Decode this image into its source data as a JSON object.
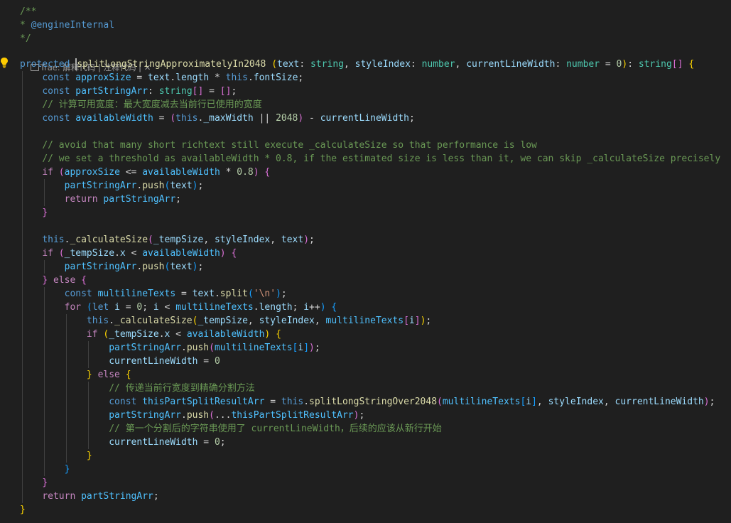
{
  "code_lens": {
    "prefix": "Trae: ",
    "explain_label": "解释代码",
    "separator": " | ",
    "comment_label": "注释代码",
    "separator2": " | ",
    "close_glyph": "✕"
  },
  "icons": {
    "lightbulb": "lightbulb-icon",
    "code_lens": "trae-code-icon"
  },
  "colors": {
    "background": "#1f1f1f",
    "keyword": "#569cd6",
    "control": "#c586c0",
    "variable": "#9cdcfe",
    "function": "#dcdcaa",
    "type": "#4ec9b0",
    "string": "#ce9178",
    "number": "#b5cea8",
    "comment": "#6a9955",
    "lightbulb": "#ffcc00"
  },
  "lines": [
    [
      [
        "cmt",
        "/**"
      ]
    ],
    [
      [
        "cmt",
        "* "
      ],
      [
        "at",
        "@engineInternal"
      ]
    ],
    [
      [
        "cmt",
        "*/"
      ]
    ],
    [
      [
        "kw",
        "protected"
      ],
      [
        "p",
        " "
      ],
      [
        "cursor",
        ""
      ],
      [
        "fn",
        "splitLongStringApproximatelyIn2048"
      ],
      [
        "p",
        " "
      ],
      [
        "b1",
        "("
      ],
      [
        "var",
        "text"
      ],
      [
        "p",
        ": "
      ],
      [
        "type",
        "string"
      ],
      [
        "p",
        ", "
      ],
      [
        "var",
        "styleIndex"
      ],
      [
        "p",
        ": "
      ],
      [
        "type",
        "number"
      ],
      [
        "p",
        ", "
      ],
      [
        "var",
        "currentLineWidth"
      ],
      [
        "p",
        ": "
      ],
      [
        "type",
        "number"
      ],
      [
        "p",
        " = "
      ],
      [
        "num",
        "0"
      ],
      [
        "b1",
        ")"
      ],
      [
        "p",
        ": "
      ],
      [
        "type",
        "string"
      ],
      [
        "b2",
        "[]"
      ],
      [
        "p",
        " "
      ],
      [
        "b1",
        "{"
      ]
    ],
    [
      [
        "p",
        "    "
      ],
      [
        "kw",
        "const"
      ],
      [
        "p",
        " "
      ],
      [
        "cst",
        "approxSize"
      ],
      [
        "p",
        " = "
      ],
      [
        "var",
        "text"
      ],
      [
        "p",
        "."
      ],
      [
        "var",
        "length"
      ],
      [
        "p",
        " * "
      ],
      [
        "kw",
        "this"
      ],
      [
        "p",
        "."
      ],
      [
        "var",
        "fontSize"
      ],
      [
        "p",
        ";"
      ]
    ],
    [
      [
        "p",
        "    "
      ],
      [
        "kw",
        "const"
      ],
      [
        "p",
        " "
      ],
      [
        "cst",
        "partStringArr"
      ],
      [
        "p",
        ": "
      ],
      [
        "type",
        "string"
      ],
      [
        "b2",
        "[]"
      ],
      [
        "p",
        " = "
      ],
      [
        "b2",
        "[]"
      ],
      [
        "p",
        ";"
      ]
    ],
    [
      [
        "p",
        "    "
      ],
      [
        "cmt",
        "// 计算可用宽度：最大宽度减去当前行已使用的宽度"
      ]
    ],
    [
      [
        "p",
        "    "
      ],
      [
        "kw",
        "const"
      ],
      [
        "p",
        " "
      ],
      [
        "cst",
        "availableWidth"
      ],
      [
        "p",
        " = "
      ],
      [
        "b2",
        "("
      ],
      [
        "kw",
        "this"
      ],
      [
        "p",
        "."
      ],
      [
        "var",
        "_maxWidth"
      ],
      [
        "p",
        " || "
      ],
      [
        "num",
        "2048"
      ],
      [
        "b2",
        ")"
      ],
      [
        "p",
        " - "
      ],
      [
        "var",
        "currentLineWidth"
      ],
      [
        "p",
        ";"
      ]
    ],
    [],
    [
      [
        "p",
        "    "
      ],
      [
        "cmt",
        "// avoid that many short richtext still execute _calculateSize so that performance is low"
      ]
    ],
    [
      [
        "p",
        "    "
      ],
      [
        "cmt",
        "// we set a threshold as availableWidth * 0.8, if the estimated size is less than it, we can skip _calculateSize precisely"
      ]
    ],
    [
      [
        "p",
        "    "
      ],
      [
        "ctl",
        "if"
      ],
      [
        "p",
        " "
      ],
      [
        "b2",
        "("
      ],
      [
        "cst",
        "approxSize"
      ],
      [
        "p",
        " <= "
      ],
      [
        "cst",
        "availableWidth"
      ],
      [
        "p",
        " * "
      ],
      [
        "num",
        "0.8"
      ],
      [
        "b2",
        ")"
      ],
      [
        "p",
        " "
      ],
      [
        "b2",
        "{"
      ]
    ],
    [
      [
        "p",
        "        "
      ],
      [
        "cst",
        "partStringArr"
      ],
      [
        "p",
        "."
      ],
      [
        "fn",
        "push"
      ],
      [
        "b3",
        "("
      ],
      [
        "var",
        "text"
      ],
      [
        "b3",
        ")"
      ],
      [
        "p",
        ";"
      ]
    ],
    [
      [
        "p",
        "        "
      ],
      [
        "ctl",
        "return"
      ],
      [
        "p",
        " "
      ],
      [
        "cst",
        "partStringArr"
      ],
      [
        "p",
        ";"
      ]
    ],
    [
      [
        "p",
        "    "
      ],
      [
        "b2",
        "}"
      ]
    ],
    [],
    [
      [
        "p",
        "    "
      ],
      [
        "kw",
        "this"
      ],
      [
        "p",
        "."
      ],
      [
        "fn",
        "_calculateSize"
      ],
      [
        "b2",
        "("
      ],
      [
        "var",
        "_tempSize"
      ],
      [
        "p",
        ", "
      ],
      [
        "var",
        "styleIndex"
      ],
      [
        "p",
        ", "
      ],
      [
        "var",
        "text"
      ],
      [
        "b2",
        ")"
      ],
      [
        "p",
        ";"
      ]
    ],
    [
      [
        "p",
        "    "
      ],
      [
        "ctl",
        "if"
      ],
      [
        "p",
        " "
      ],
      [
        "b2",
        "("
      ],
      [
        "var",
        "_tempSize"
      ],
      [
        "p",
        "."
      ],
      [
        "var",
        "x"
      ],
      [
        "p",
        " < "
      ],
      [
        "cst",
        "availableWidth"
      ],
      [
        "b2",
        ")"
      ],
      [
        "p",
        " "
      ],
      [
        "b2",
        "{"
      ]
    ],
    [
      [
        "p",
        "        "
      ],
      [
        "cst",
        "partStringArr"
      ],
      [
        "p",
        "."
      ],
      [
        "fn",
        "push"
      ],
      [
        "b3",
        "("
      ],
      [
        "var",
        "text"
      ],
      [
        "b3",
        ")"
      ],
      [
        "p",
        ";"
      ]
    ],
    [
      [
        "p",
        "    "
      ],
      [
        "b2",
        "}"
      ],
      [
        "p",
        " "
      ],
      [
        "ctl",
        "else"
      ],
      [
        "p",
        " "
      ],
      [
        "b2",
        "{"
      ]
    ],
    [
      [
        "p",
        "        "
      ],
      [
        "kw",
        "const"
      ],
      [
        "p",
        " "
      ],
      [
        "cst",
        "multilineTexts"
      ],
      [
        "p",
        " = "
      ],
      [
        "var",
        "text"
      ],
      [
        "p",
        "."
      ],
      [
        "fn",
        "split"
      ],
      [
        "b3",
        "("
      ],
      [
        "str",
        "'\\n'"
      ],
      [
        "b3",
        ")"
      ],
      [
        "p",
        ";"
      ]
    ],
    [
      [
        "p",
        "        "
      ],
      [
        "ctl",
        "for"
      ],
      [
        "p",
        " "
      ],
      [
        "b3",
        "("
      ],
      [
        "kw",
        "let"
      ],
      [
        "p",
        " "
      ],
      [
        "var",
        "i"
      ],
      [
        "p",
        " = "
      ],
      [
        "num",
        "0"
      ],
      [
        "p",
        "; "
      ],
      [
        "var",
        "i"
      ],
      [
        "p",
        " < "
      ],
      [
        "cst",
        "multilineTexts"
      ],
      [
        "p",
        "."
      ],
      [
        "var",
        "length"
      ],
      [
        "p",
        "; "
      ],
      [
        "var",
        "i"
      ],
      [
        "p",
        "++"
      ],
      [
        "b3",
        ")"
      ],
      [
        "p",
        " "
      ],
      [
        "b3",
        "{"
      ]
    ],
    [
      [
        "p",
        "            "
      ],
      [
        "kw",
        "this"
      ],
      [
        "p",
        "."
      ],
      [
        "fn",
        "_calculateSize"
      ],
      [
        "b1",
        "("
      ],
      [
        "var",
        "_tempSize"
      ],
      [
        "p",
        ", "
      ],
      [
        "var",
        "styleIndex"
      ],
      [
        "p",
        ", "
      ],
      [
        "cst",
        "multilineTexts"
      ],
      [
        "b2",
        "["
      ],
      [
        "var",
        "i"
      ],
      [
        "b2",
        "]"
      ],
      [
        "b1",
        ")"
      ],
      [
        "p",
        ";"
      ]
    ],
    [
      [
        "p",
        "            "
      ],
      [
        "ctl",
        "if"
      ],
      [
        "p",
        " "
      ],
      [
        "b1",
        "("
      ],
      [
        "var",
        "_tempSize"
      ],
      [
        "p",
        "."
      ],
      [
        "var",
        "x"
      ],
      [
        "p",
        " < "
      ],
      [
        "cst",
        "availableWidth"
      ],
      [
        "b1",
        ")"
      ],
      [
        "p",
        " "
      ],
      [
        "b1",
        "{"
      ]
    ],
    [
      [
        "p",
        "                "
      ],
      [
        "cst",
        "partStringArr"
      ],
      [
        "p",
        "."
      ],
      [
        "fn",
        "push"
      ],
      [
        "b2",
        "("
      ],
      [
        "cst",
        "multilineTexts"
      ],
      [
        "b3",
        "["
      ],
      [
        "var",
        "i"
      ],
      [
        "b3",
        "]"
      ],
      [
        "b2",
        ")"
      ],
      [
        "p",
        ";"
      ]
    ],
    [
      [
        "p",
        "                "
      ],
      [
        "var",
        "currentLineWidth"
      ],
      [
        "p",
        " = "
      ],
      [
        "num",
        "0"
      ]
    ],
    [
      [
        "p",
        "            "
      ],
      [
        "b1",
        "}"
      ],
      [
        "p",
        " "
      ],
      [
        "ctl",
        "else"
      ],
      [
        "p",
        " "
      ],
      [
        "b1",
        "{"
      ]
    ],
    [
      [
        "p",
        "                "
      ],
      [
        "cmt",
        "// 传递当前行宽度到精确分割方法"
      ]
    ],
    [
      [
        "p",
        "                "
      ],
      [
        "kw",
        "const"
      ],
      [
        "p",
        " "
      ],
      [
        "cst",
        "thisPartSplitResultArr"
      ],
      [
        "p",
        " = "
      ],
      [
        "kw",
        "this"
      ],
      [
        "p",
        "."
      ],
      [
        "fn",
        "splitLongStringOver2048"
      ],
      [
        "b2",
        "("
      ],
      [
        "cst",
        "multilineTexts"
      ],
      [
        "b3",
        "["
      ],
      [
        "var",
        "i"
      ],
      [
        "b3",
        "]"
      ],
      [
        "p",
        ", "
      ],
      [
        "var",
        "styleIndex"
      ],
      [
        "p",
        ", "
      ],
      [
        "var",
        "currentLineWidth"
      ],
      [
        "b2",
        ")"
      ],
      [
        "p",
        ";"
      ]
    ],
    [
      [
        "p",
        "                "
      ],
      [
        "cst",
        "partStringArr"
      ],
      [
        "p",
        "."
      ],
      [
        "fn",
        "push"
      ],
      [
        "b2",
        "("
      ],
      [
        "p",
        "..."
      ],
      [
        "cst",
        "thisPartSplitResultArr"
      ],
      [
        "b2",
        ")"
      ],
      [
        "p",
        ";"
      ]
    ],
    [
      [
        "p",
        "                "
      ],
      [
        "cmt",
        "// 第一个分割后的字符串使用了 currentLineWidth，后续的应该从新行开始"
      ]
    ],
    [
      [
        "p",
        "                "
      ],
      [
        "var",
        "currentLineWidth"
      ],
      [
        "p",
        " = "
      ],
      [
        "num",
        "0"
      ],
      [
        "p",
        ";"
      ]
    ],
    [
      [
        "p",
        "            "
      ],
      [
        "b1",
        "}"
      ]
    ],
    [
      [
        "p",
        "        "
      ],
      [
        "b3",
        "}"
      ]
    ],
    [
      [
        "p",
        "    "
      ],
      [
        "b2",
        "}"
      ]
    ],
    [
      [
        "p",
        "    "
      ],
      [
        "ctl",
        "return"
      ],
      [
        "p",
        " "
      ],
      [
        "cst",
        "partStringArr"
      ],
      [
        "p",
        ";"
      ]
    ],
    [
      [
        "b1",
        "}"
      ]
    ]
  ]
}
